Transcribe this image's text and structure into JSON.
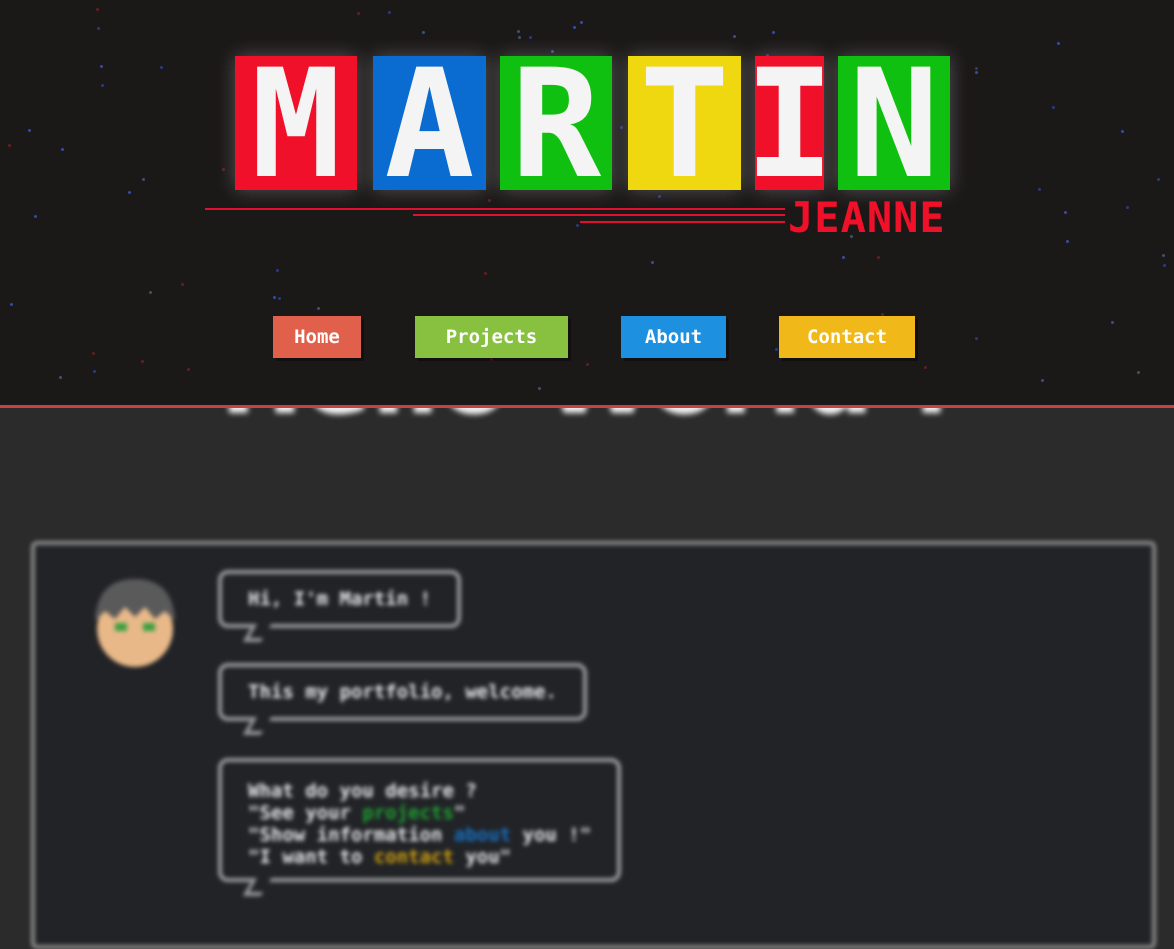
{
  "header": {
    "logo_letters": [
      {
        "char": "M",
        "color": "#f0102a"
      },
      {
        "char": "A",
        "color": "#0a6cd0"
      },
      {
        "char": "R",
        "color": "#10c010"
      },
      {
        "char": "T",
        "color": "#f0d810"
      },
      {
        "char": "I",
        "color": "#f0102a"
      },
      {
        "char": "N",
        "color": "#10c010"
      }
    ],
    "subtitle": "JEANNE",
    "border_color": "#c94040"
  },
  "nav": [
    {
      "label": "Home",
      "color": "#e0604c"
    },
    {
      "label": "Projects",
      "color": "#88c040"
    },
    {
      "label": "About",
      "color": "#1e90e0"
    },
    {
      "label": "Contact",
      "color": "#f0b818"
    }
  ],
  "main": {
    "heading": "Hello World !",
    "bubbles": {
      "greeting": "Hi, I'm Martin !",
      "welcome": "This my portfolio, welcome.",
      "question": "What do you desire ?",
      "opt1_pre": "\"See your ",
      "opt1_link": "projects",
      "opt1_post": "\"",
      "opt2_pre": "\"Show information ",
      "opt2_link": "about",
      "opt2_post": " you !\"",
      "opt3_pre": "\"I want to ",
      "opt3_link": "contact",
      "opt3_post": " you\""
    }
  }
}
